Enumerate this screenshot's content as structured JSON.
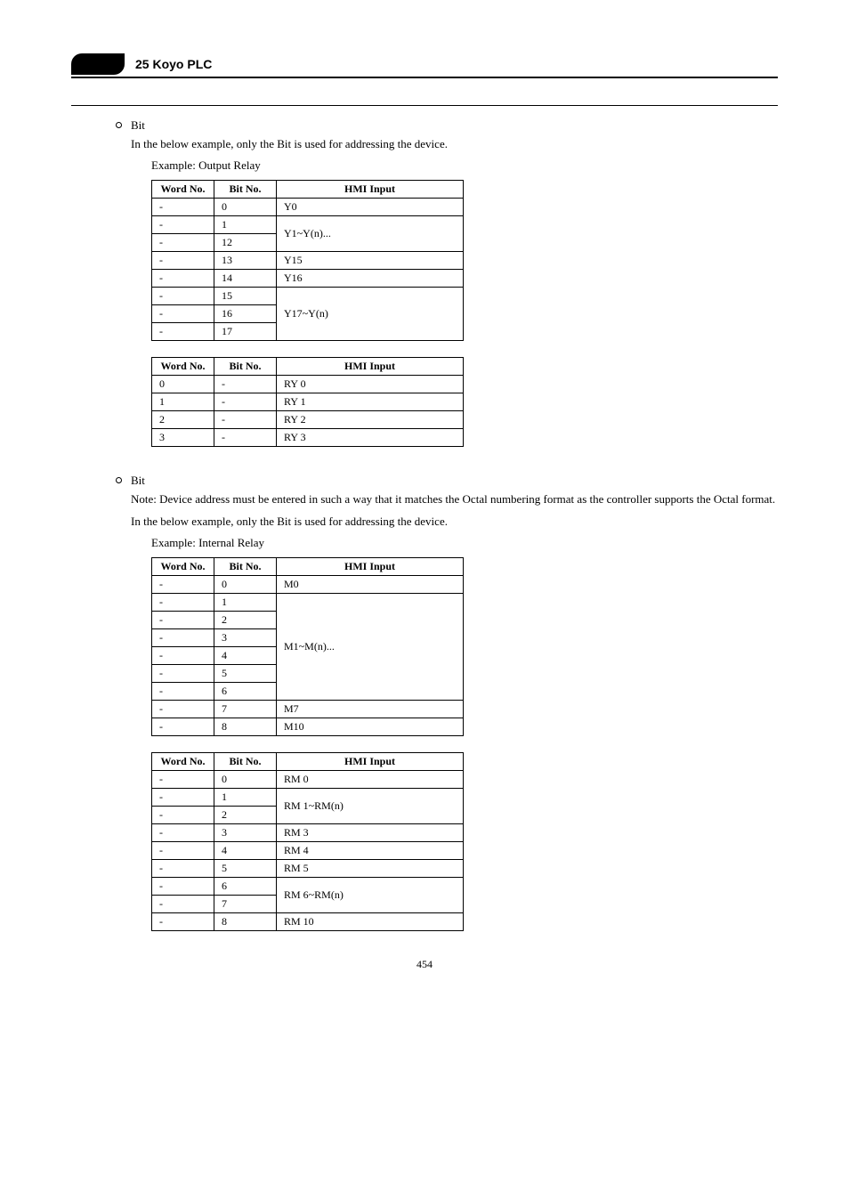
{
  "header": {
    "title": "25 Koyo PLC"
  },
  "section1": {
    "bullet": "Bit",
    "desc": "In the below example, only the Bit is used for addressing the device.",
    "exampleLabel": "Example: Output Relay",
    "table_out": {
      "headers": [
        "Word No.",
        "Bit No.",
        "HMI Input"
      ],
      "rows": [
        [
          [
            "-",
            "0",
            "Y0"
          ]
        ],
        [
          [
            "-",
            "1"
          ],
          [
            "-",
            "12"
          ],
          {
            "span": "Y1~Y(n)..."
          }
        ],
        [
          [
            "-",
            "13",
            "Y15"
          ]
        ],
        [
          [
            "-",
            "14",
            "Y16"
          ]
        ],
        [
          [
            "-",
            "15"
          ],
          [
            "-",
            "16"
          ],
          [
            "-",
            "17"
          ],
          {
            "span": "Y17~Y(n)"
          }
        ]
      ]
    },
    "table_outreg": {
      "headers": [
        "Word No.",
        "Bit No.",
        "HMI Input"
      ],
      "rows": [
        [
          "0",
          "-",
          "RY 0"
        ],
        [
          "1",
          "-",
          "RY 1"
        ],
        [
          "2",
          "-",
          "RY 2"
        ],
        [
          "3",
          "-",
          "RY 3"
        ]
      ]
    }
  },
  "section2": {
    "bullet": "Bit",
    "desc1": "Note: Device address must be entered in such a way that it matches the Octal numbering format as the controller supports the Octal format.",
    "desc2": "In the below example, only the Bit is used for addressing the device.",
    "exampleLabel": "Example: Internal Relay",
    "table_int": {
      "headers": [
        "Word No.",
        "Bit No.",
        "HMI Input"
      ],
      "rows": [
        [
          [
            "-",
            "0",
            "M0"
          ]
        ],
        [
          [
            "-",
            "1"
          ],
          [
            "-",
            "2"
          ],
          [
            "-",
            "3"
          ],
          [
            "-",
            "4"
          ],
          [
            "-",
            "5"
          ],
          [
            "-",
            "6"
          ],
          {
            "span": "M1~M(n)..."
          }
        ],
        [
          [
            "-",
            "7",
            "M7"
          ]
        ],
        [
          [
            "-",
            "8",
            "M10"
          ]
        ]
      ]
    },
    "table_intreg": {
      "headers": [
        "Word No.",
        "Bit No.",
        "HMI Input"
      ],
      "rows": [
        [
          [
            "-",
            "0",
            "RM 0"
          ]
        ],
        [
          [
            "-",
            "1"
          ],
          [
            "-",
            "2"
          ],
          {
            "span": "RM 1~RM(n)"
          }
        ],
        [
          [
            "-",
            "3",
            "RM 3"
          ]
        ],
        [
          [
            "-",
            "4",
            "RM 4"
          ]
        ],
        [
          [
            "-",
            "5",
            "RM 5"
          ]
        ],
        [
          [
            "-",
            "6"
          ],
          [
            "-",
            "7"
          ],
          {
            "span": "RM 6~RM(n)"
          }
        ],
        [
          [
            "-",
            "8",
            "RM 10"
          ]
        ]
      ]
    }
  },
  "footer": "454"
}
